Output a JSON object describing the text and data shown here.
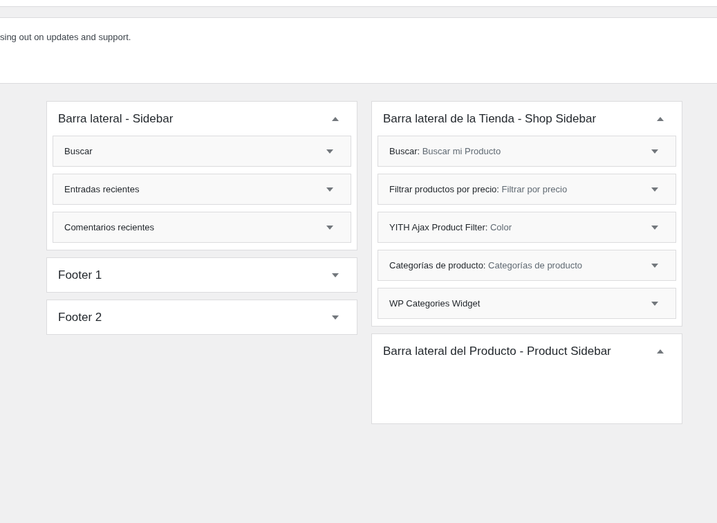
{
  "notice": {
    "text": "sing out on updates and support."
  },
  "columns": [
    {
      "areas": [
        {
          "title": "Barra lateral - Sidebar",
          "expanded": true,
          "widgets": [
            {
              "title": "Buscar"
            },
            {
              "title": "Entradas recientes"
            },
            {
              "title": "Comentarios recientes"
            }
          ]
        },
        {
          "title": "Footer 1",
          "expanded": false
        },
        {
          "title": "Footer 2",
          "expanded": false
        }
      ]
    },
    {
      "areas": [
        {
          "title": "Barra lateral de la Tienda - Shop Sidebar",
          "expanded": true,
          "widgets": [
            {
              "title": "Buscar:",
              "subtitle": "Buscar mi Producto"
            },
            {
              "title": "Filtrar productos por precio:",
              "subtitle": "Filtrar por precio"
            },
            {
              "title": "YITH Ajax Product Filter:",
              "subtitle": "Color"
            },
            {
              "title": "Categorías de producto:",
              "subtitle": "Categorías de producto"
            },
            {
              "title": "WP Categories Widget"
            }
          ]
        },
        {
          "title": "Barra lateral del Producto - Product Sidebar",
          "expanded": true
        }
      ]
    }
  ]
}
